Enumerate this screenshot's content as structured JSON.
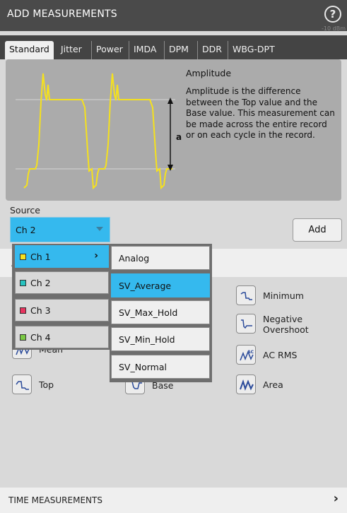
{
  "header": {
    "title": "ADD MEASUREMENTS",
    "help_glyph": "?",
    "ghost_text": "-10 dBm"
  },
  "tabs": [
    {
      "label": "Standard",
      "active": true
    },
    {
      "label": "Jitter"
    },
    {
      "label": "Power"
    },
    {
      "label": "IMDA"
    },
    {
      "label": "DPM"
    },
    {
      "label": "DDR"
    },
    {
      "label": "WBG-DPT"
    }
  ],
  "description": {
    "title": "Amplitude",
    "text": "Amplitude is the difference between the Top value and the Base value. This measurement can be made across the entire record or on each cycle in the record.",
    "marker": "a"
  },
  "source": {
    "label": "Source",
    "value": "Ch 2",
    "add_label": "Add",
    "channels": [
      {
        "name": "Ch 1",
        "color": "#f5e11e",
        "selected": true,
        "has_submenu": true
      },
      {
        "name": "Ch 2",
        "color": "#27c3c0"
      },
      {
        "name": "Ch 3",
        "color": "#e8345f"
      },
      {
        "name": "Ch 4",
        "color": "#7ac943"
      }
    ],
    "submenu": [
      {
        "name": "Analog"
      },
      {
        "name": "SV_Average",
        "selected": true
      },
      {
        "name": "SV_Max_Hold"
      },
      {
        "name": "SV_Min_Hold"
      },
      {
        "name": "SV_Normal"
      }
    ]
  },
  "section": {
    "label_fragment": "A"
  },
  "measurements": [
    {
      "label": "Minimum",
      "icon": "minimum-icon"
    },
    {
      "label": "Negative\nOvershoot",
      "icon": "negative-overshoot-icon"
    },
    {
      "label": "Mean",
      "icon": "mean-icon"
    },
    {
      "label": "AC RMS",
      "icon": "ac-rms-icon"
    },
    {
      "label": "Top",
      "icon": "top-icon"
    },
    {
      "label": "Base",
      "icon": "base-icon"
    },
    {
      "label": "Area",
      "icon": "area-icon"
    }
  ],
  "footer": {
    "label": "TIME MEASUREMENTS",
    "chevron": "›"
  },
  "colors": {
    "accent": "#35b9ee",
    "waveform": "#f5e11e",
    "header_bg": "#4a4a4a",
    "icon_blue": "#2a4a9a"
  }
}
